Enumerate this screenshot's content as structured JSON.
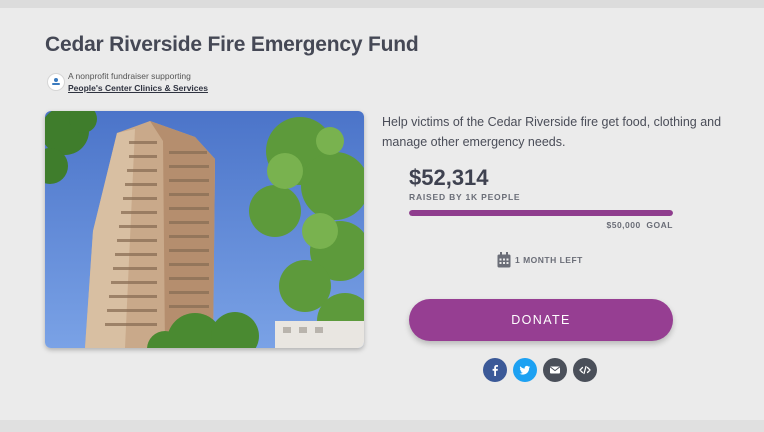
{
  "fundraiser": {
    "title": "Cedar Riverside Fire Emergency Fund",
    "org_prefix": "A nonprofit fundraiser supporting",
    "org_name": "People's Center Clinics & Services",
    "description": "Help victims of the Cedar Riverside fire get food, clothing and manage other emergency needs.",
    "amount_raised": "$52,314",
    "raised_by": "RAISED BY 1K PEOPLE",
    "goal": "$50,000  GOAL",
    "progress_fraction": 1.0,
    "time_left": "1 MONTH LEFT",
    "donate_label": "DONATE"
  },
  "share": {
    "icons": [
      "facebook-icon",
      "twitter-icon",
      "email-icon",
      "embed-icon"
    ]
  },
  "colors": {
    "accent": "#963e92",
    "progress": "#8f3d8e",
    "facebook": "#3b5998",
    "twitter": "#1da1f2",
    "dark_icon": "#4a4f59",
    "background": "#ebebeb"
  }
}
